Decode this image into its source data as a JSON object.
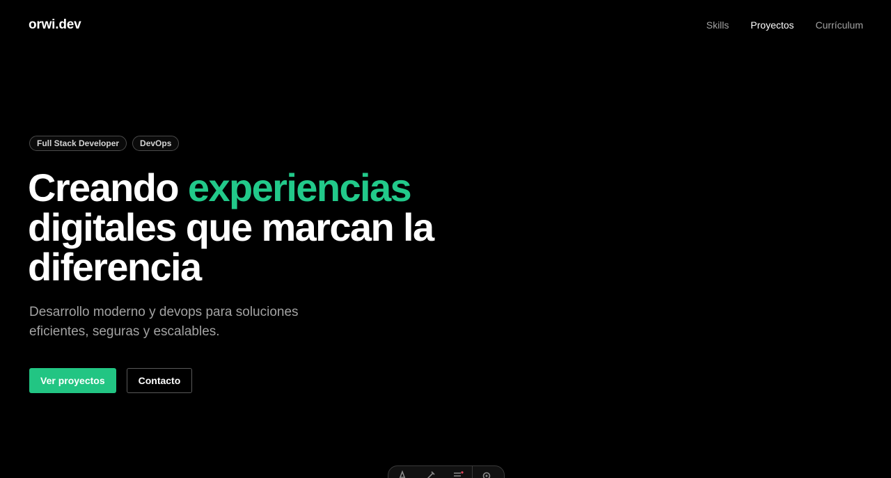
{
  "header": {
    "logo": "orwi.dev",
    "nav": {
      "skills": "Skills",
      "proyectos": "Proyectos",
      "curriculum": "Currículum"
    }
  },
  "hero": {
    "badges": [
      "Full Stack Developer",
      "DevOps"
    ],
    "headline": {
      "prefix": "Creando ",
      "accent": "experiencias",
      "rest": "digitales que marcan la diferencia"
    },
    "subtitle": "Desarrollo moderno y devops para soluciones eficientes, seguras y escalables.",
    "primary_button": "Ver proyectos",
    "secondary_button": "Contacto"
  },
  "colors": {
    "background": "#000000",
    "accent": "#22c98a",
    "button_primary": "#22c583",
    "muted_text": "#a3a3a3"
  },
  "dock": {
    "icons": [
      "font-icon",
      "brush-icon",
      "list-icon",
      "settings-icon"
    ]
  }
}
